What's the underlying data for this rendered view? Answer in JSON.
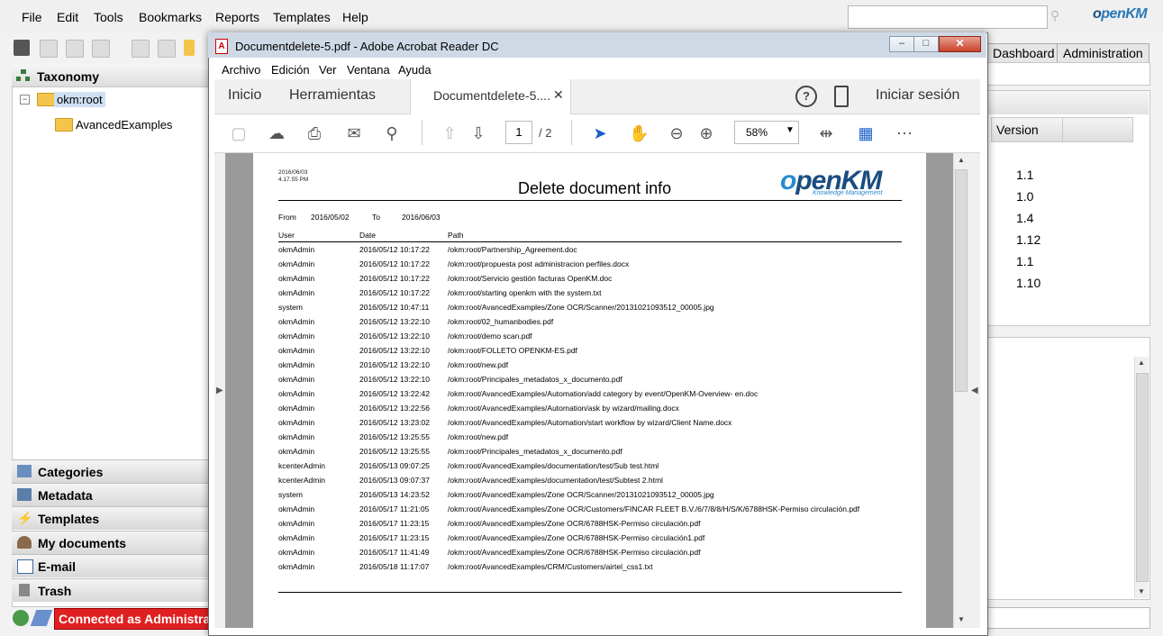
{
  "okm": {
    "menu": [
      "File",
      "Edit",
      "Tools",
      "Bookmarks",
      "Reports",
      "Templates",
      "Help"
    ],
    "logo": {
      "o": "o",
      "rest": "penKM"
    },
    "search_placeholder": "",
    "taxonomy_title": "Taxonomy",
    "tree": {
      "root": "okm:root",
      "child": "AvancedExamples"
    },
    "accordion": [
      "Categories",
      "Metadata",
      "Templates",
      "My documents",
      "E-mail",
      "Trash"
    ],
    "status": "Connected as Administrator",
    "tabs": {
      "dashboard": "Dashboard",
      "administration": "Administration"
    },
    "version_header": "Version",
    "versions": [
      "1.1",
      "1.0",
      "1.4",
      "1.12",
      "1.1",
      "1.10"
    ]
  },
  "acrobat": {
    "title": "Documentdelete-5.pdf - Adobe Acrobat Reader DC",
    "pdf_icon": "A",
    "window_buttons": {
      "minimize": "–",
      "maximize": "□",
      "close": "✕"
    },
    "menu": [
      "Archivo",
      "Edición",
      "Ver",
      "Ventana",
      "Ayuda"
    ],
    "tabs": {
      "home": "Inicio",
      "tools": "Herramientas",
      "doc": "Documentdelete-5....",
      "close": "✕",
      "signin": "Iniciar sesión"
    },
    "page_current": "1",
    "page_total": "/ 2",
    "zoom": "58%"
  },
  "report": {
    "date": "2016/06/03",
    "time": "4.17.55 PM",
    "title": "Delete document info",
    "logo_main": "penKM",
    "logo_o": "o",
    "logo_sub": "Knowledge Management",
    "from_label": "From",
    "from": "2016/05/02",
    "to_label": "To",
    "to": "2016/06/03",
    "headers": [
      "User",
      "Date",
      "Path"
    ],
    "rows": [
      [
        "okmAdmin",
        "2016/05/12 10:17:22",
        "/okm:root/Partnership_Agreement.doc"
      ],
      [
        "okmAdmin",
        "2016/05/12 10:17:22",
        "/okm:root/propuesta post administracion perfiles.docx"
      ],
      [
        "okmAdmin",
        "2016/05/12 10:17:22",
        "/okm:root/Servicio gestión facturas OpenKM.doc"
      ],
      [
        "okmAdmin",
        "2016/05/12 10:17:22",
        "/okm:root/starting openkm with the system.txt"
      ],
      [
        "system",
        "2016/05/12 10:47:11",
        "/okm:root/AvancedExamples/Zone OCR/Scanner/20131021093512_00005.jpg"
      ],
      [
        "okmAdmin",
        "2016/05/12 13:22:10",
        "/okm:root/02_humanbodies.pdf"
      ],
      [
        "okmAdmin",
        "2016/05/12 13:22:10",
        "/okm:root/demo scan.pdf"
      ],
      [
        "okmAdmin",
        "2016/05/12 13:22:10",
        "/okm:root/FOLLETO OPENKM-ES.pdf"
      ],
      [
        "okmAdmin",
        "2016/05/12 13:22:10",
        "/okm:root/new.pdf"
      ],
      [
        "okmAdmin",
        "2016/05/12 13:22:10",
        "/okm:root/Principales_metadatos_x_documento.pdf"
      ],
      [
        "okmAdmin",
        "2016/05/12 13:22:42",
        "/okm:root/AvancedExamples/Automation/add category by event/OpenKM-Overview- en.doc"
      ],
      [
        "okmAdmin",
        "2016/05/12 13:22:56",
        "/okm:root/AvancedExamples/Automation/ask by wizard/mailing.docx"
      ],
      [
        "okmAdmin",
        "2016/05/12 13:23:02",
        "/okm:root/AvancedExamples/Automation/start workflow by wizard/Client Name.docx"
      ],
      [
        "okmAdmin",
        "2016/05/12 13:25:55",
        "/okm:root/new.pdf"
      ],
      [
        "okmAdmin",
        "2016/05/12 13:25:55",
        "/okm:root/Principales_metadatos_x_documento.pdf"
      ],
      [
        "kcenterAdmin",
        "2016/05/13 09:07:25",
        "/okm:root/AvancedExamples/documentation/test/Sub test.html"
      ],
      [
        "kcenterAdmin",
        "2016/05/13 09:07:37",
        "/okm:root/AvancedExamples/documentation/test/Subtest 2.html"
      ],
      [
        "system",
        "2016/05/13 14:23:52",
        "/okm:root/AvancedExamples/Zone OCR/Scanner/20131021093512_00005.jpg"
      ],
      [
        "okmAdmin",
        "2016/05/17 11:21:05",
        "/okm:root/AvancedExamples/Zone OCR/Customers/FINCAR FLEET B.V./6/7/8/8/H/S/K/6788HSK-Permiso circulación.pdf"
      ],
      [
        "okmAdmin",
        "2016/05/17 11:23:15",
        "/okm:root/AvancedExamples/Zone OCR/6788HSK-Permiso circulación.pdf"
      ],
      [
        "okmAdmin",
        "2016/05/17 11:23:15",
        "/okm:root/AvancedExamples/Zone OCR/6788HSK-Permiso circulación1.pdf"
      ],
      [
        "okmAdmin",
        "2016/05/17 11:41:49",
        "/okm:root/AvancedExamples/Zone OCR/6788HSK-Permiso circulación.pdf"
      ],
      [
        "okmAdmin",
        "2016/05/18 11:17:07",
        "/okm:root/AvancedExamples/CRM/Customers/airtel_css1.txt"
      ]
    ]
  }
}
